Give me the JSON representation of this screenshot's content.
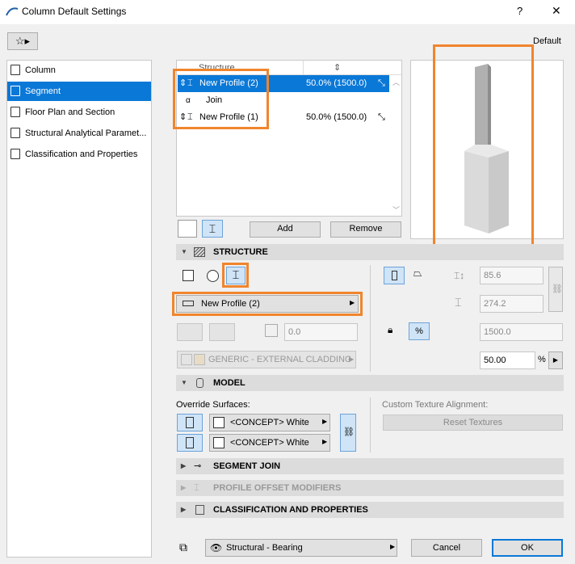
{
  "window": {
    "title": "Column Default Settings",
    "help": "?",
    "close": "✕"
  },
  "favorites_label": "Favorites",
  "default_label": "Default",
  "nav": [
    {
      "label": "Column",
      "icon": "column-icon"
    },
    {
      "label": "Segment",
      "icon": "segment-icon"
    },
    {
      "label": "Floor Plan and Section",
      "icon": "floor-plan-icon"
    },
    {
      "label": "Structural Analytical Paramet...",
      "icon": "structural-analytical-icon"
    },
    {
      "label": "Classification and Properties",
      "icon": "classification-icon"
    }
  ],
  "segment_table": {
    "headers": [
      "Structure",
      "⇕"
    ],
    "rows": [
      {
        "name": "New Profile (2)",
        "value": "50.0% (1500.0)",
        "selected": true
      },
      {
        "name": "Join",
        "value": ""
      },
      {
        "name": "New Profile (1)",
        "value": "50.0% (1500.0)"
      }
    ],
    "add": "Add",
    "remove": "Remove"
  },
  "structure": {
    "title": "STRUCTURE",
    "profile": "New Profile (2)",
    "offset": "0.0",
    "material": "GENERIC - EXTERNAL CLADDING",
    "width": "85.6",
    "depth": "274.2",
    "length": "1500.0",
    "percent": "50.00",
    "percent_unit": "%"
  },
  "model": {
    "title": "MODEL",
    "override_label": "Override Surfaces:",
    "surface1": "<CONCEPT> White",
    "surface2": "<CONCEPT> White",
    "texture_label": "Custom Texture Alignment:",
    "reset": "Reset Textures"
  },
  "sections": {
    "segment_join": "SEGMENT JOIN",
    "profile_offset": "PROFILE OFFSET MODIFIERS",
    "classification": "CLASSIFICATION AND PROPERTIES"
  },
  "footer": {
    "layer": "Structural - Bearing",
    "cancel": "Cancel",
    "ok": "OK"
  },
  "colors": {
    "accent": "#0a78d7",
    "highlight": "#f0852d"
  }
}
